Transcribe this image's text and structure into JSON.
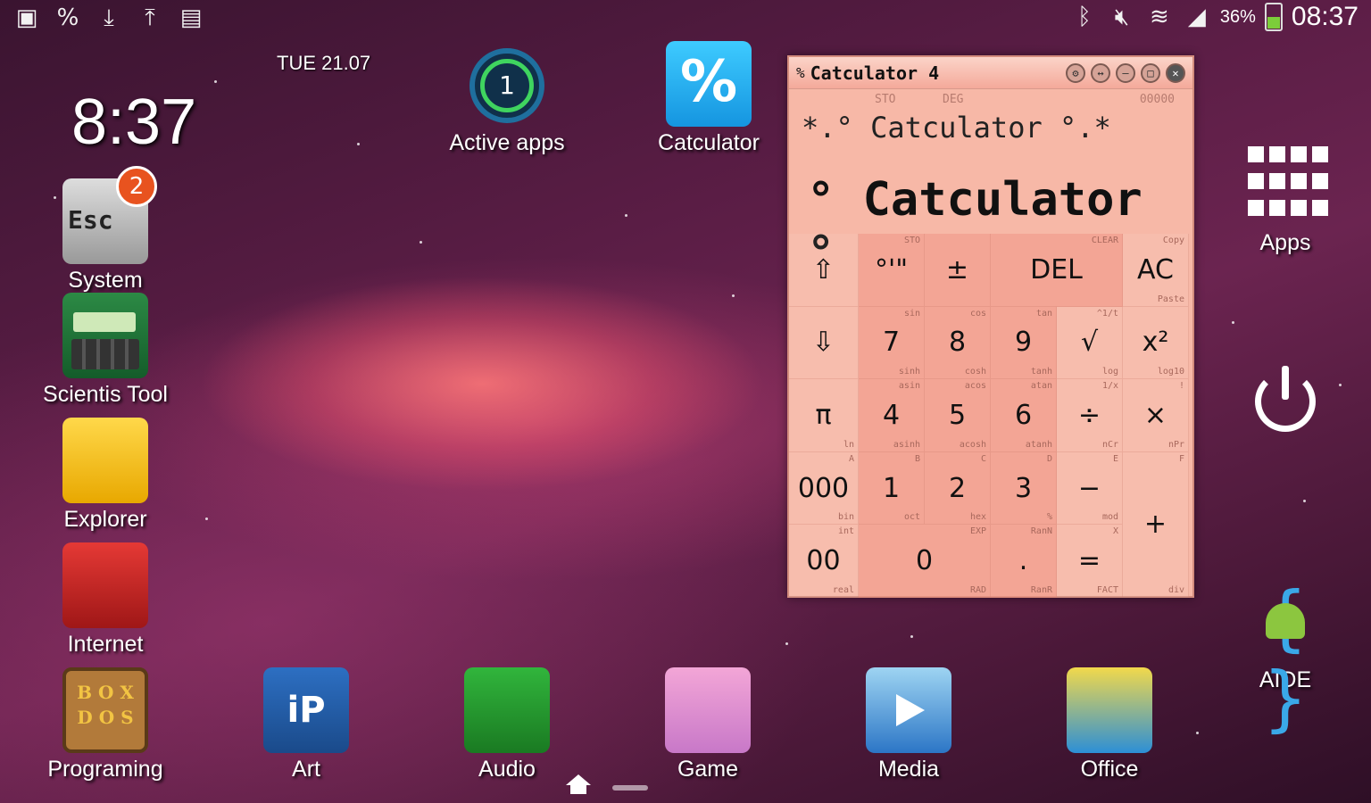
{
  "status_bar": {
    "left_icons": [
      "gallery-icon",
      "calculator-notify-icon",
      "download-icon",
      "upload-icon",
      "file-icon"
    ],
    "battery_percent": "36%",
    "time": "08:37"
  },
  "clock_widget": {
    "date": "TUE  21.07",
    "time": "8:37"
  },
  "desktop": {
    "left_column": [
      {
        "label": "System",
        "badge": "2",
        "icon_text": "Esc"
      },
      {
        "label": "Scientis Tool"
      },
      {
        "label": "Explorer"
      },
      {
        "label": "Internet"
      }
    ],
    "top_row": [
      {
        "label": "Active apps",
        "badge": "1"
      },
      {
        "label": "Catculator",
        "icon_text": "%"
      }
    ],
    "right_column": [
      {
        "label": "Apps"
      },
      {
        "label": ""
      },
      {
        "label": "AIDE"
      }
    ],
    "dock": [
      {
        "label": "Programing",
        "icon_text": "B O X D O S"
      },
      {
        "label": "Art",
        "icon_text": "iP"
      },
      {
        "label": "Audio"
      },
      {
        "label": "Game"
      },
      {
        "label": "Media"
      },
      {
        "label": "Office"
      }
    ]
  },
  "calculator": {
    "title": "Catculator 4",
    "icon_glyph": "%",
    "mode_sto": "STO",
    "mode_deg": "DEG",
    "memory": "00000",
    "display_line1": "*.° Catculator °.*",
    "display_line2": "° Catculator °",
    "keys": [
      [
        "⇧",
        "°'\"",
        "±",
        "DEL",
        "",
        "AC"
      ],
      [
        "⇩",
        "7",
        "8",
        "9",
        "√",
        "x²"
      ],
      [
        "π",
        "4",
        "5",
        "6",
        "÷",
        "×"
      ],
      [
        "000",
        "1",
        "2",
        "3",
        "−",
        "+"
      ],
      [
        "00",
        "0",
        "",
        ".",
        "=",
        ""
      ]
    ],
    "key_labels": {
      "sto": "STO",
      "clear": "CLEAR",
      "copy": "Copy",
      "paste": "Paste",
      "sin": "sin",
      "cos": "cos",
      "tan": "tan",
      "inv": "^1/t",
      "sinh": "sinh",
      "cosh": "cosh",
      "tanh": "tanh",
      "log": "log",
      "log10": "log10",
      "asin": "asin",
      "acos": "acos",
      "atan": "atan",
      "one_over": "1/x",
      "fact_sym": "!",
      "ln": "ln",
      "asinh": "asinh",
      "acosh": "acosh",
      "atanh": "atanh",
      "ncr": "nCr",
      "npr": "nPr",
      "A": "A",
      "B": "B",
      "C": "C",
      "D": "D",
      "E": "E",
      "F": "F",
      "bin": "bin",
      "oct": "oct",
      "hex": "hex",
      "pct": "%",
      "mod": "mod",
      "int": "int",
      "exp": "EXP",
      "rand": "RanN",
      "x": "X",
      "real": "real",
      "rad": "RAD",
      "ranr": "RanR",
      "fact": "FACT",
      "div": "div"
    }
  },
  "colors": {
    "accent": "#f7b8a7",
    "badge": "#e8531f",
    "calc_icon": "#2fb4f5"
  }
}
